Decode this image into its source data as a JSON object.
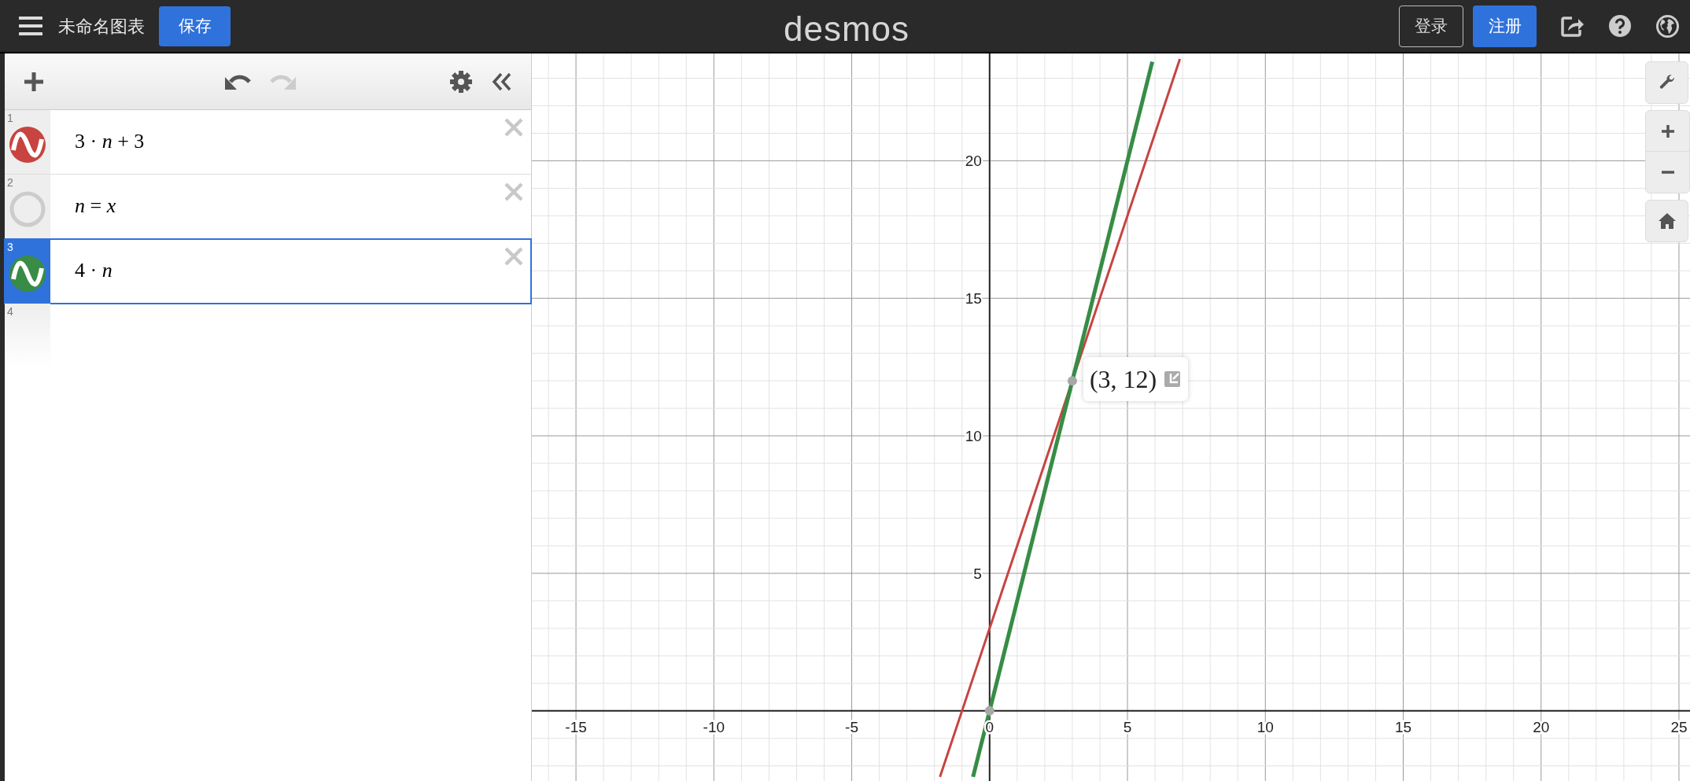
{
  "header": {
    "title": "未命名图表",
    "save_button": "保存",
    "logo": "desmos",
    "login_button": "登录",
    "signup_button": "注册"
  },
  "toolbar": {
    "undo_disabled": false,
    "redo_disabled": true
  },
  "expressions": [
    {
      "index": "1",
      "expression": "3 · *n* + 3",
      "kind": "graph",
      "color": "#c74440",
      "selected": false
    },
    {
      "index": "2",
      "expression": "*n* = *x*",
      "kind": "hidden",
      "color": "#cccccc",
      "selected": false
    },
    {
      "index": "3",
      "expression": "4 · *n*",
      "kind": "graph",
      "color": "#388c46",
      "selected": true
    },
    {
      "index": "4",
      "kind": "empty",
      "selected": false
    }
  ],
  "graph": {
    "chart_data": {
      "type": "line",
      "x": [
        -1.8,
        -0.6,
        5.9,
        6.9
      ],
      "series": [
        {
          "color": "#c74440",
          "values": [
            -2.4,
            1.2,
            20.7,
            23.7
          ]
        },
        {
          "color": "#388c46",
          "values": [
            null,
            -2.4,
            23.6,
            null
          ]
        }
      ],
      "xlim": [
        -16.6,
        25.4
      ],
      "ylim": [
        -2.55,
        23.9
      ],
      "xticks": [
        -15,
        -10,
        -5,
        0,
        5,
        10,
        15,
        20,
        25
      ],
      "yticks": [
        5,
        10,
        15,
        20
      ],
      "grid": true,
      "annotations": [
        {
          "x": 3,
          "y": 12,
          "text": "(3, 12)"
        }
      ]
    }
  }
}
